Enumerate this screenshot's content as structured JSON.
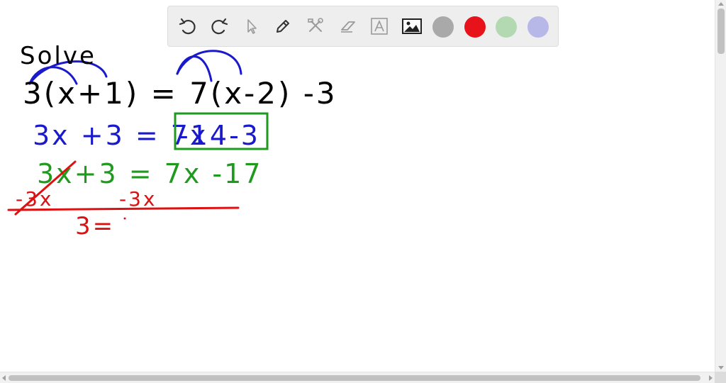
{
  "canvas": {
    "lines": [
      {
        "text": "Solve",
        "color": "#000000"
      },
      {
        "text": "3(x+1) = 7(x-2) -3",
        "color": "#000000"
      },
      {
        "text": "3x +3 = 7x",
        "color": "#1a1acc"
      },
      {
        "text": "-14-3",
        "color": "#1a1acc"
      },
      {
        "text": "3x+3 = 7x -17",
        "color": "#1e9a1e"
      },
      {
        "text": "-3x",
        "color": "#dd1111"
      },
      {
        "text": "-3x",
        "color": "#dd1111"
      },
      {
        "text": "3=",
        "color": "#dd1111"
      }
    ],
    "box_color": "#1e9a1e",
    "arc_color": "#1a1acc"
  },
  "toolbar": {
    "tools": [
      {
        "name": "undo-icon"
      },
      {
        "name": "redo-icon"
      },
      {
        "name": "select-cursor-icon"
      },
      {
        "name": "pen-icon"
      },
      {
        "name": "tools-icon"
      },
      {
        "name": "eraser-icon"
      },
      {
        "name": "text-icon"
      },
      {
        "name": "image-icon"
      }
    ],
    "colors": [
      "#a9a9a9",
      "#e8121a",
      "#b3d9b3",
      "#b8b8e8"
    ]
  }
}
